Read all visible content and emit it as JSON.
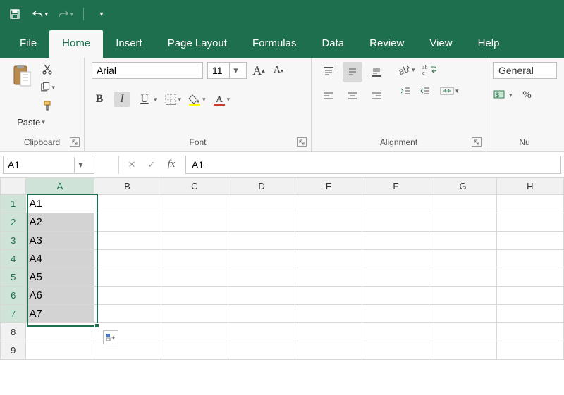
{
  "qat": {
    "save": "save",
    "undo": "undo",
    "redo": "redo"
  },
  "tabs": {
    "file": "File",
    "home": "Home",
    "insert": "Insert",
    "page_layout": "Page Layout",
    "formulas": "Formulas",
    "data": "Data",
    "review": "Review",
    "view": "View",
    "help": "Help",
    "active": "home"
  },
  "ribbon": {
    "clipboard": {
      "label": "Clipboard",
      "paste": "Paste"
    },
    "font": {
      "label": "Font",
      "name": "Arial",
      "size": "11",
      "bold": "B",
      "italic": "I",
      "underline": "U"
    },
    "alignment": {
      "label": "Alignment"
    },
    "number": {
      "label": "Number",
      "format": "General"
    }
  },
  "formula_bar": {
    "namebox": "A1",
    "content": "A1",
    "fx": "fx"
  },
  "sheet": {
    "columns": [
      "A",
      "B",
      "C",
      "D",
      "E",
      "F",
      "G",
      "H"
    ],
    "rows": [
      "1",
      "2",
      "3",
      "4",
      "5",
      "6",
      "7",
      "8",
      "9"
    ],
    "data": {
      "A1": "A1",
      "A2": "A2",
      "A3": "A3",
      "A4": "A4",
      "A5": "A5",
      "A6": "A6",
      "A7": "A7"
    },
    "selection": {
      "col": "A",
      "rowStart": 1,
      "rowEnd": 7,
      "active": "A1"
    }
  }
}
